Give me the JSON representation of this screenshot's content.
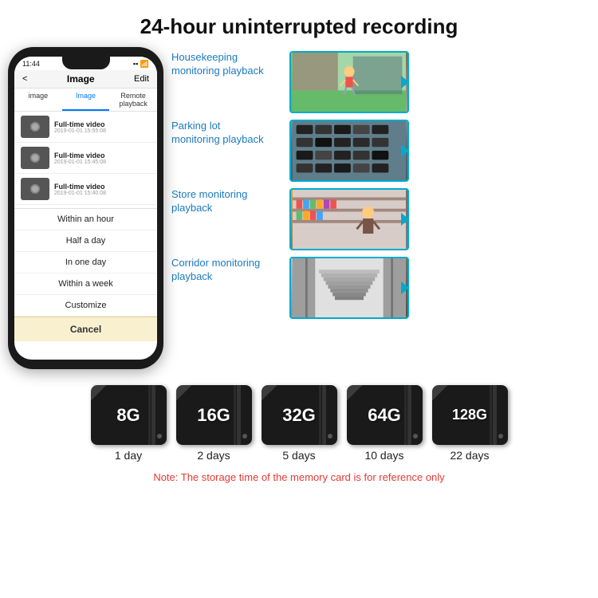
{
  "title": "24-hour uninterrupted recording",
  "phone": {
    "time": "11:44",
    "header_back": "<",
    "header_title": "Image",
    "header_edit": "Edit",
    "tabs": [
      "image",
      "Image",
      "Remote playback"
    ],
    "active_tab": 1,
    "list_items": [
      {
        "title": "Full-time video",
        "date": "2019-01-01 15:55:08"
      },
      {
        "title": "Full-time video",
        "date": "2019-01-01 15:45:08"
      },
      {
        "title": "Full-time video",
        "date": "2019-01-01 15:40:08"
      }
    ],
    "dropdown_items": [
      "Within an hour",
      "Half a day",
      "In one day",
      "Within a week",
      "Customize"
    ],
    "cancel_label": "Cancel"
  },
  "monitoring": [
    {
      "label": "Housekeeping\nmonitoring playback",
      "image_type": "child"
    },
    {
      "label": "Parking lot\nmonitoring playback",
      "image_type": "parking"
    },
    {
      "label": "Store monitoring\nplayback",
      "image_type": "store"
    },
    {
      "label": "Corridor monitoring\nplayback",
      "image_type": "corridor"
    }
  ],
  "storage": {
    "cards": [
      {
        "size": "8G",
        "days": "1 day"
      },
      {
        "size": "16G",
        "days": "2 days"
      },
      {
        "size": "32G",
        "days": "5 days"
      },
      {
        "size": "64G",
        "days": "10 days"
      },
      {
        "size": "128G",
        "days": "22 days"
      }
    ],
    "note": "Note: The storage time of the memory card is for reference only"
  }
}
